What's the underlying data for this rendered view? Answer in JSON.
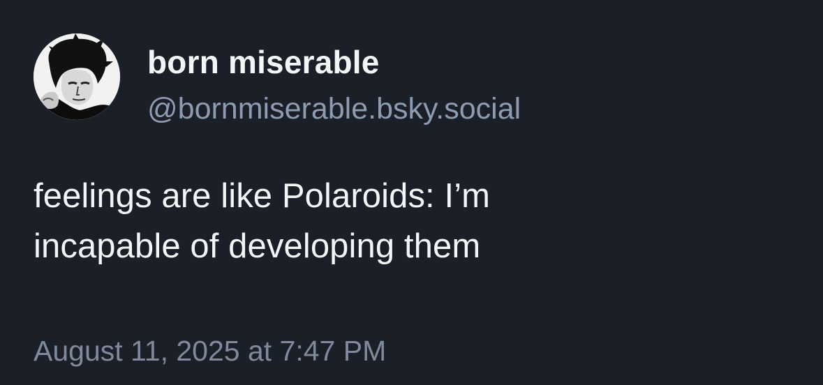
{
  "post": {
    "author": {
      "display_name": "born miserable",
      "handle": "@bornmiserable.bsky.social",
      "avatar_icon": "user-avatar"
    },
    "text_lines": [
      "feelings are like Polaroids: I’m",
      "incapable of developing them"
    ],
    "timestamp": "August 11, 2025 at 7:47 PM"
  },
  "colors": {
    "background": "#1b1f28",
    "primary_text": "#f4f5f7",
    "handle_text": "#8e9cb2",
    "timestamp_text": "#7f8a9c"
  }
}
